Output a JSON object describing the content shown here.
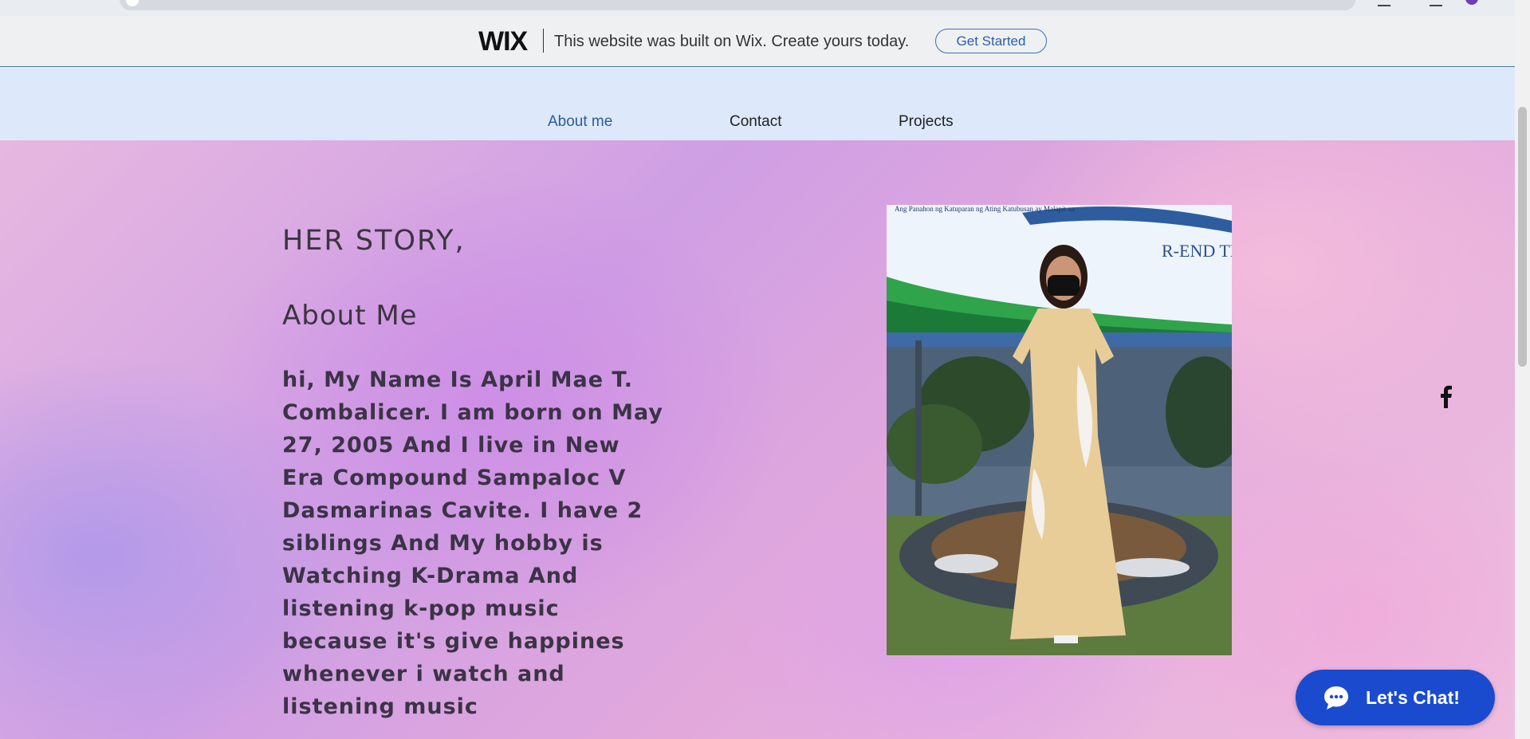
{
  "banner": {
    "logo": "WIX",
    "message": "This website was built on Wix. Create yours today.",
    "cta_label": "Get Started"
  },
  "nav": {
    "items": [
      {
        "label": "About me",
        "active": true
      },
      {
        "label": "Contact",
        "active": false
      },
      {
        "label": "Projects",
        "active": false
      }
    ]
  },
  "content": {
    "section_title": "HER STORY,",
    "heading": "About Me",
    "body": "hi, My Name Is April Mae T. Combalicer. I am born on May 27, 2005 And I live in New Era Compound Sampaloc V Dasmarinas Cavite. I have 2 siblings And My hobby is Watching K-Drama And listening k-pop music because it's give happines whenever i watch and listening music"
  },
  "photo": {
    "sign_lines": [
      "Ang Panahon ng Katuparan ng Ating Katubusan ay Malapit na"
    ],
    "sign_heading": "R-END THANKS"
  },
  "social": {
    "icon": "facebook-icon"
  },
  "chat": {
    "label": "Let's Chat!",
    "icon": "chat-bubble-icon",
    "color": "#1a4bcf"
  },
  "colors": {
    "nav_active": "#2b5aa0",
    "nav_background": "#dde9fa",
    "banner_button": "#3c6fb6"
  }
}
